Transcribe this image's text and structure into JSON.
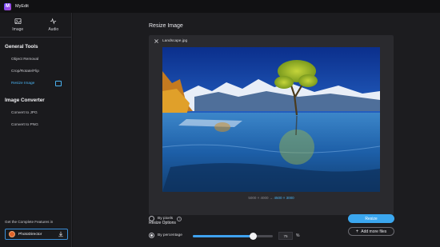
{
  "app": {
    "logo_letter": "M",
    "title": "MyEdit"
  },
  "sidebar": {
    "media_tabs": [
      {
        "label": "Image",
        "icon": "image-icon"
      },
      {
        "label": "Audio",
        "icon": "audio-icon"
      }
    ],
    "general_tools_title": "General Tools",
    "general_tools": [
      {
        "label": "Object Removal"
      },
      {
        "label": "Crop/Rotate/Flip"
      },
      {
        "label": "Resize Image",
        "active": true
      }
    ],
    "converter_title": "Image Converter",
    "converter_items": [
      {
        "label": "Convert to JPG"
      },
      {
        "label": "Convert to PNG"
      }
    ],
    "promo_text": "Get the Complete Features in",
    "promo_product": "PhotoDirector"
  },
  "main": {
    "title": "Resize Image",
    "file_name": "Landscape.jpg",
    "original_dims": "5000 × 4000",
    "arrow": "→",
    "new_dims": "4500 × 3000",
    "options_title": "Resize Options",
    "by_pixels_label": "By pixels",
    "by_percentage_label": "By percentage",
    "percentage_value": "75",
    "percent_sign": "%",
    "slider_level_percent": 75,
    "resize_button": "Resize",
    "add_files_button": "Add more files"
  },
  "colors": {
    "accent": "#3ba7ef",
    "background": "#1c1c1f",
    "sidebar": "#1a1a1d"
  }
}
